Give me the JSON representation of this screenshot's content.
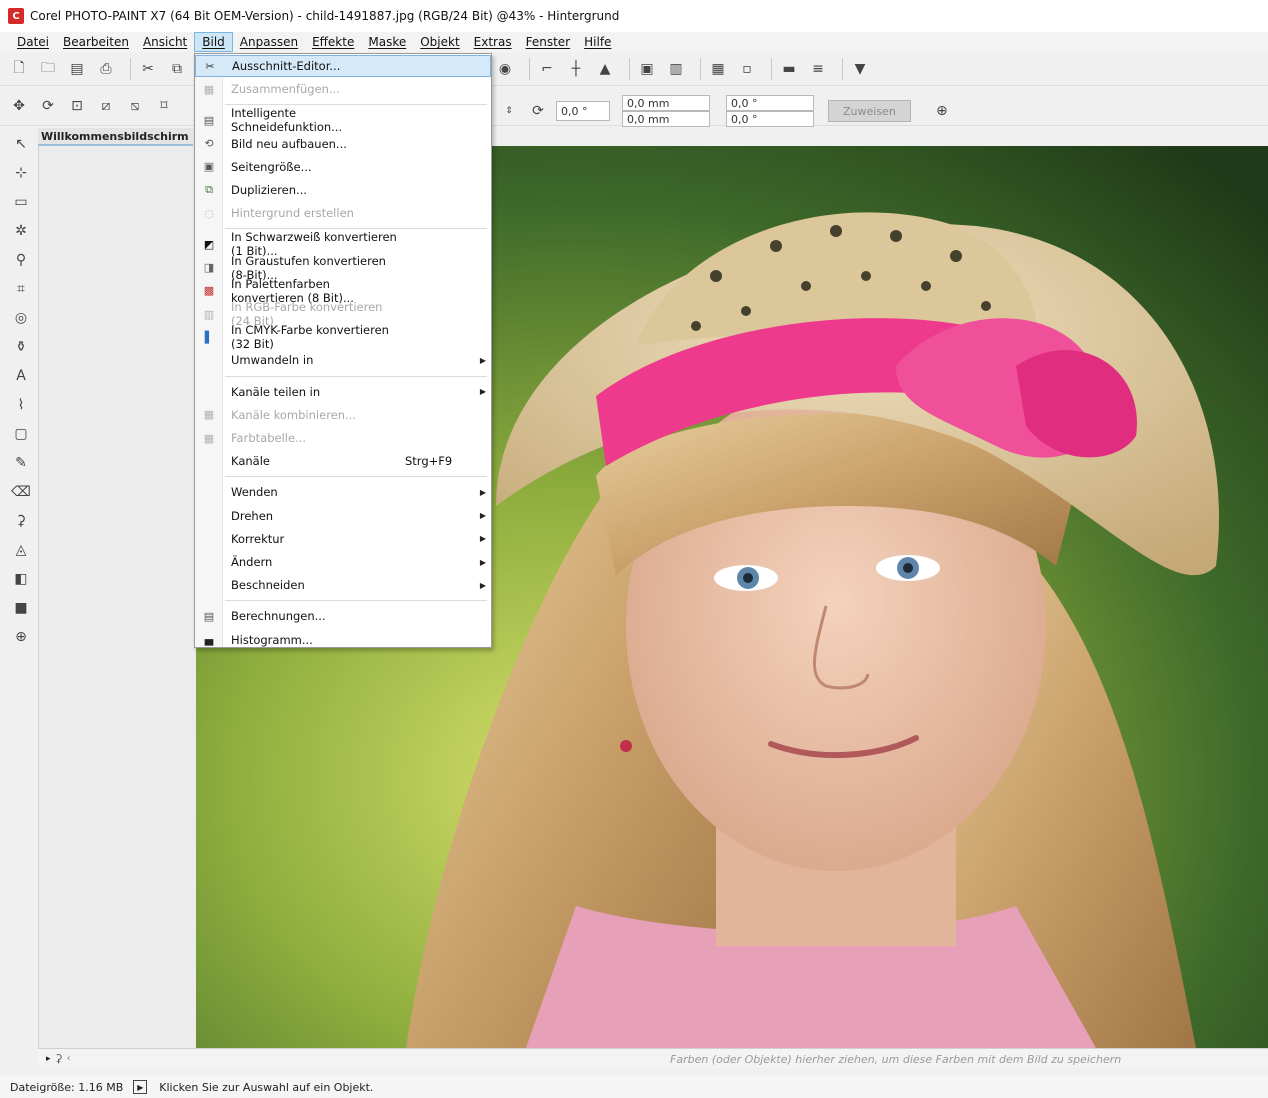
{
  "window": {
    "title": "Corel PHOTO-PAINT X7 (64 Bit OEM-Version) - child-1491887.jpg (RGB/24 Bit) @43% - Hintergrund",
    "logo_letter": "C"
  },
  "menubar": {
    "items": [
      "Datei",
      "Bearbeiten",
      "Ansicht",
      "Bild",
      "Anpassen",
      "Effekte",
      "Maske",
      "Objekt",
      "Extras",
      "Fenster",
      "Hilfe"
    ],
    "active": "Bild"
  },
  "property_bar": {
    "angle_1": "0,0 °",
    "offset_x": "0,0 mm",
    "offset_y": "0,0 mm",
    "size_w": "0,0 °",
    "size_h": "0,0 °",
    "apply_label": "Zuweisen"
  },
  "docker": {
    "welcome_tab": "Willkommensbildschirm"
  },
  "dropdown": {
    "items": [
      {
        "label": "Ausschnitt-Editor...",
        "disabled": false,
        "submenu": false,
        "shortcut": "",
        "icon": "crop-editor-icon",
        "color": "#333333",
        "highlight": true
      },
      {
        "label": "Zusammenfügen...",
        "disabled": true,
        "submenu": false,
        "shortcut": "",
        "icon": "merge-icon",
        "color": "#b0b0b0"
      },
      {
        "label": "Intelligente Schneidefunktion...",
        "disabled": false,
        "submenu": false,
        "shortcut": "",
        "icon": "smart-carver-icon",
        "color": "#555555",
        "sep_before": true
      },
      {
        "label": "Bild neu aufbauen...",
        "disabled": false,
        "submenu": false,
        "shortcut": "",
        "icon": "resample-icon",
        "color": "#555555"
      },
      {
        "label": "Seitengröße...",
        "disabled": false,
        "submenu": false,
        "shortcut": "",
        "icon": "paper-size-icon",
        "color": "#555555"
      },
      {
        "label": "Duplizieren...",
        "disabled": false,
        "submenu": false,
        "shortcut": "",
        "icon": "duplicate-icon",
        "color": "#3a7a3a"
      },
      {
        "label": "Hintergrund erstellen",
        "disabled": true,
        "submenu": false,
        "shortcut": "",
        "icon": "background-icon",
        "color": "#b0b0b0"
      },
      {
        "label": "In Schwarzweiß konvertieren (1 Bit)...",
        "disabled": false,
        "submenu": false,
        "shortcut": "",
        "icon": "bw-icon",
        "color": "#111111",
        "sep_before": true
      },
      {
        "label": "In Graustufen konvertieren (8-Bit)...",
        "disabled": false,
        "submenu": false,
        "shortcut": "",
        "icon": "grayscale-icon",
        "color": "#666666"
      },
      {
        "label": "In Palettenfarben konvertieren (8 Bit)...",
        "disabled": false,
        "submenu": false,
        "shortcut": "",
        "icon": "palette-icon",
        "color": "#c03030"
      },
      {
        "label": "In RGB-Farbe konvertieren (24 Bit)",
        "disabled": true,
        "submenu": false,
        "shortcut": "",
        "icon": "rgb-icon",
        "color": "#b0b0b0"
      },
      {
        "label": "In CMYK-Farbe konvertieren (32 Bit)",
        "disabled": false,
        "submenu": false,
        "shortcut": "",
        "icon": "cmyk-icon",
        "color": "#2a6fc0"
      },
      {
        "label": "Umwandeln in",
        "disabled": false,
        "submenu": true,
        "shortcut": "",
        "icon": "",
        "color": "#333333"
      },
      {
        "label": "Kanäle teilen in",
        "disabled": false,
        "submenu": true,
        "shortcut": "",
        "icon": "",
        "color": "#333333",
        "sep_before": true
      },
      {
        "label": "Kanäle kombinieren...",
        "disabled": true,
        "submenu": false,
        "shortcut": "",
        "icon": "combine-channels-icon",
        "color": "#b0b0b0"
      },
      {
        "label": "Farbtabelle...",
        "disabled": true,
        "submenu": false,
        "shortcut": "",
        "icon": "color-table-icon",
        "color": "#b0b0b0"
      },
      {
        "label": "Kanäle",
        "disabled": false,
        "submenu": false,
        "shortcut": "Strg+F9",
        "icon": "",
        "color": "#333333"
      },
      {
        "label": "Wenden",
        "disabled": false,
        "submenu": true,
        "shortcut": "",
        "icon": "",
        "color": "#333333",
        "sep_before": true
      },
      {
        "label": "Drehen",
        "disabled": false,
        "submenu": true,
        "shortcut": "",
        "icon": "",
        "color": "#333333"
      },
      {
        "label": "Korrektur",
        "disabled": false,
        "submenu": true,
        "shortcut": "",
        "icon": "",
        "color": "#333333"
      },
      {
        "label": "Ändern",
        "disabled": false,
        "submenu": true,
        "shortcut": "",
        "icon": "",
        "color": "#333333"
      },
      {
        "label": "Beschneiden",
        "disabled": false,
        "submenu": true,
        "shortcut": "",
        "icon": "",
        "color": "#333333"
      },
      {
        "label": "Berechnungen...",
        "disabled": false,
        "submenu": false,
        "shortcut": "",
        "icon": "calculations-icon",
        "color": "#555555",
        "sep_before": true
      },
      {
        "label": "Histogramm...",
        "disabled": false,
        "submenu": false,
        "shortcut": "",
        "icon": "histogram-icon",
        "color": "#222222"
      }
    ]
  },
  "palette_strip": {
    "hint": "Farben (oder Objekte) hierher ziehen, um diese Farben mit dem Bild zu speichern"
  },
  "statusbar": {
    "file_size": "Dateigröße: 1.16 MB",
    "message": "Klicken Sie zur Auswahl auf ein Objekt."
  },
  "colors": {
    "accent": "#7eb4e0",
    "menu_highlight": "#d6e9f8",
    "hat_ribbon": "#ee3a8c",
    "hat_straw": "#d8c49a"
  }
}
